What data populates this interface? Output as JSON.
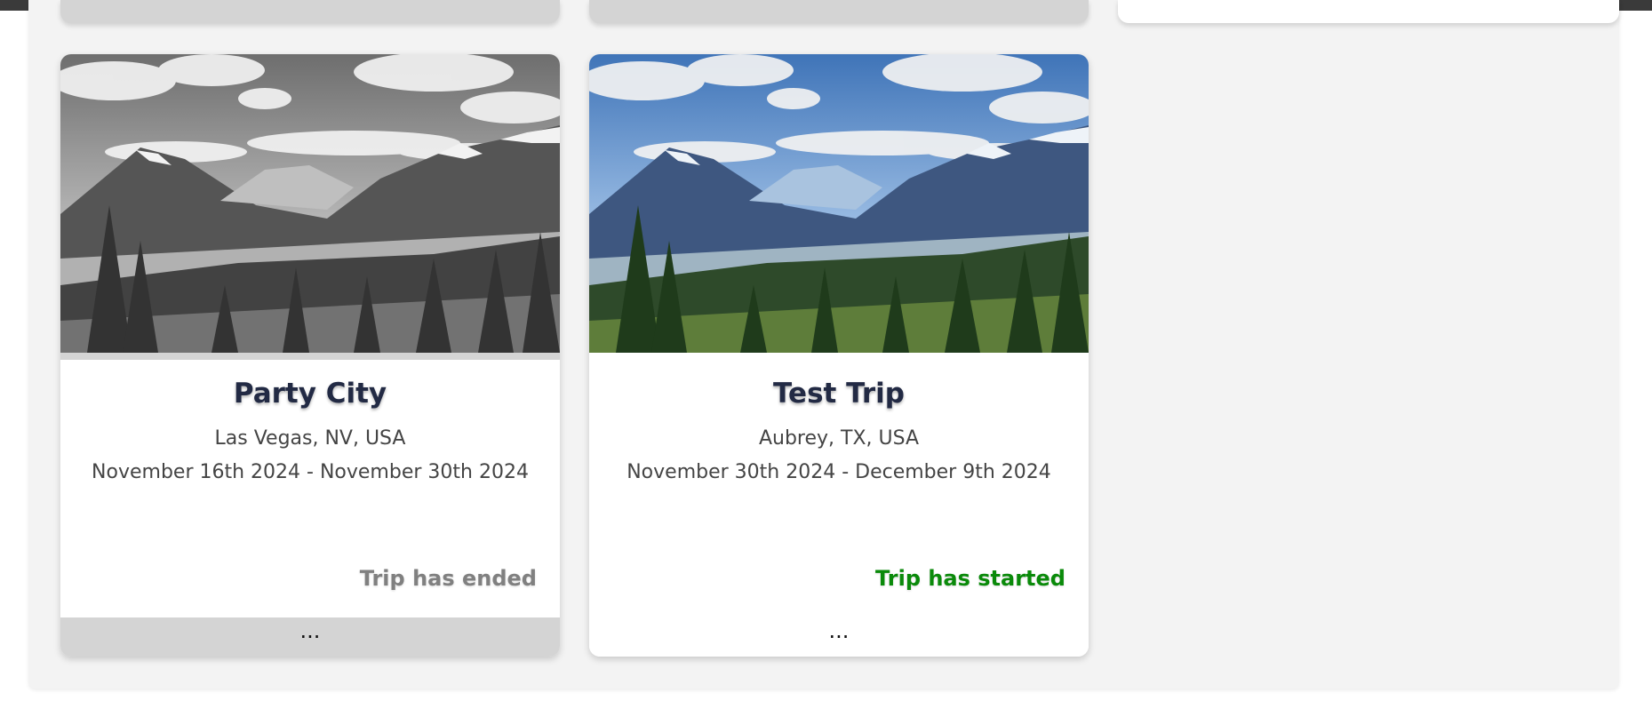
{
  "trips": [
    {
      "title": "Party City",
      "location": "Las Vegas, NV, USA",
      "dates": "November 16th 2024 - November 30th 2024",
      "status": "Trip has ended",
      "status_color": "#808080",
      "menu_label": "...",
      "image_icon": "mountain-landscape-image"
    },
    {
      "title": "Test Trip",
      "location": "Aubrey, TX, USA",
      "dates": "November 30th 2024 - December 9th 2024",
      "status": "Trip has started",
      "status_color": "#0a8a0a",
      "menu_label": "...",
      "image_icon": "mountain-landscape-image"
    }
  ]
}
